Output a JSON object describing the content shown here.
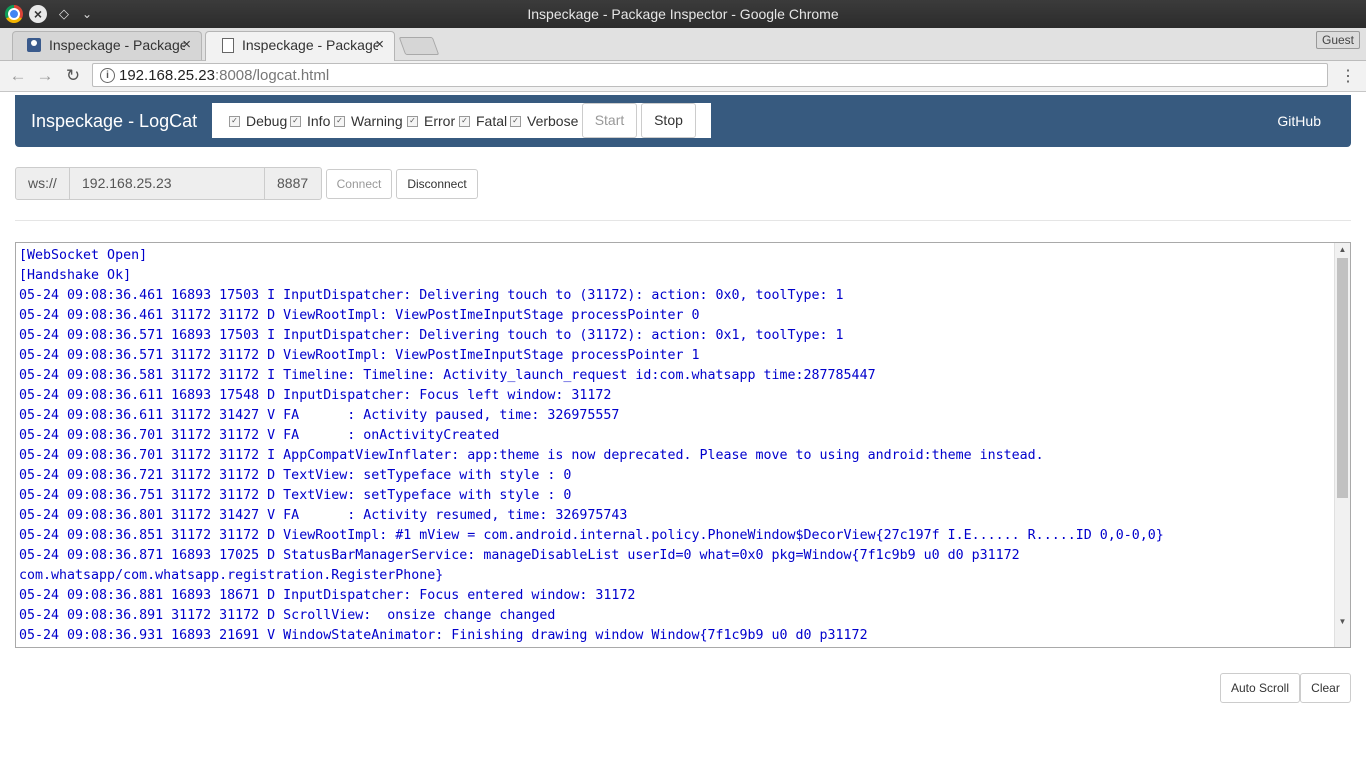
{
  "window": {
    "title": "Inspeckage - Package Inspector - Google Chrome"
  },
  "tabs": [
    {
      "label": "Inspeckage - Package Inspector"
    },
    {
      "label": "Inspeckage - Package Inspector"
    }
  ],
  "browser": {
    "guest_label": "Guest",
    "url_host": "192.168.25.23",
    "url_rest": ":8008/logcat.html"
  },
  "navbar": {
    "brand": "Inspeckage - LogCat",
    "levels": [
      {
        "label": "Debug",
        "checked": true
      },
      {
        "label": "Info",
        "checked": true
      },
      {
        "label": "Warning",
        "checked": true
      },
      {
        "label": "Error",
        "checked": true
      },
      {
        "label": "Fatal",
        "checked": true
      },
      {
        "label": "Verbose",
        "checked": true
      }
    ],
    "start_label": "Start",
    "stop_label": "Stop",
    "github_label": "GitHub"
  },
  "connection": {
    "scheme": "ws://",
    "host": "192.168.25.23",
    "port": "8887",
    "connect_label": "Connect",
    "disconnect_label": "Disconnect"
  },
  "log": {
    "lines": [
      "[WebSocket Open]",
      "[Handshake Ok]",
      "05-24 09:08:36.461 16893 17503 I InputDispatcher: Delivering touch to (31172): action: 0x0, toolType: 1",
      "05-24 09:08:36.461 31172 31172 D ViewRootImpl: ViewPostImeInputStage processPointer 0",
      "05-24 09:08:36.571 16893 17503 I InputDispatcher: Delivering touch to (31172): action: 0x1, toolType: 1",
      "05-24 09:08:36.571 31172 31172 D ViewRootImpl: ViewPostImeInputStage processPointer 1",
      "05-24 09:08:36.581 31172 31172 I Timeline: Timeline: Activity_launch_request id:com.whatsapp time:287785447",
      "05-24 09:08:36.611 16893 17548 D InputDispatcher: Focus left window: 31172",
      "05-24 09:08:36.611 31172 31427 V FA      : Activity paused, time: 326975557",
      "05-24 09:08:36.701 31172 31172 V FA      : onActivityCreated",
      "05-24 09:08:36.701 31172 31172 I AppCompatViewInflater: app:theme is now deprecated. Please move to using android:theme instead.",
      "05-24 09:08:36.721 31172 31172 D TextView: setTypeface with style : 0",
      "05-24 09:08:36.751 31172 31172 D TextView: setTypeface with style : 0",
      "05-24 09:08:36.801 31172 31427 V FA      : Activity resumed, time: 326975743",
      "05-24 09:08:36.851 31172 31172 D ViewRootImpl: #1 mView = com.android.internal.policy.PhoneWindow$DecorView{27c197f I.E...... R.....ID 0,0-0,0}",
      "05-24 09:08:36.871 16893 17025 D StatusBarManagerService: manageDisableList userId=0 what=0x0 pkg=Window{7f1c9b9 u0 d0 p31172",
      "com.whatsapp/com.whatsapp.registration.RegisterPhone}",
      "05-24 09:08:36.881 16893 18671 D InputDispatcher: Focus entered window: 31172",
      "05-24 09:08:36.891 31172 31172 D ScrollView:  onsize change changed",
      "05-24 09:08:36.931 16893 21691 V WindowStateAnimator: Finishing drawing window Window{7f1c9b9 u0 d0 p31172"
    ]
  },
  "actions": {
    "auto_scroll_label": "Auto Scroll",
    "clear_label": "Clear"
  }
}
